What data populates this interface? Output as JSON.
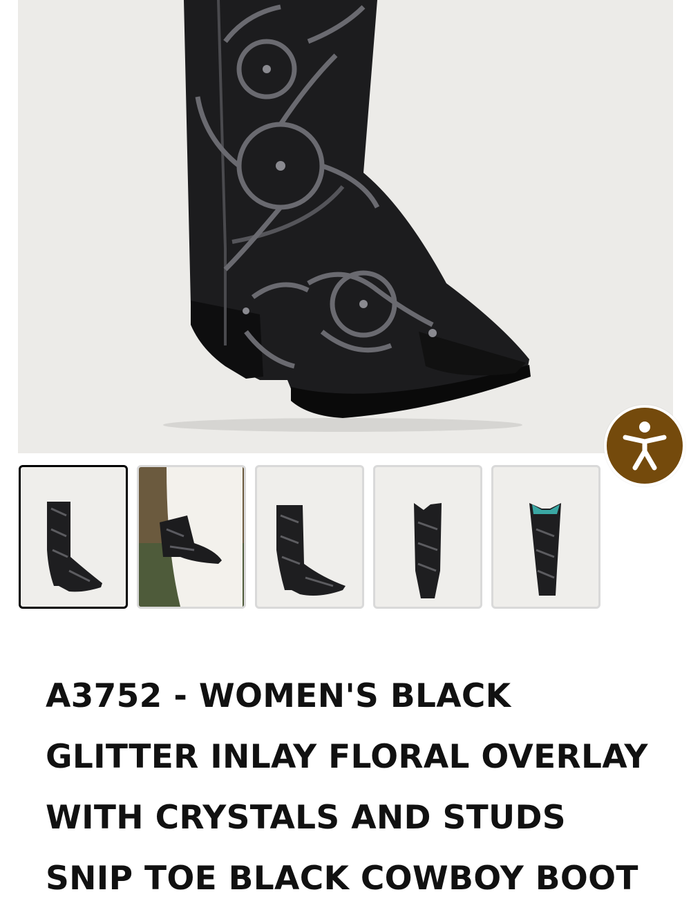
{
  "product": {
    "title_lines": [
      "A3752 - WOMEN'S BLACK",
      "GLITTER INLAY FLORAL OVERLAY",
      "WITH CRYSTALS AND STUDS",
      "SNIP TOE BLACK COWBOY BOOT"
    ]
  },
  "gallery": {
    "main_image": "boot-photo",
    "thumbnails": [
      {
        "name": "thumbnail-1",
        "selected": true
      },
      {
        "name": "thumbnail-2",
        "selected": false
      },
      {
        "name": "thumbnail-3",
        "selected": false
      },
      {
        "name": "thumbnail-4",
        "selected": false
      },
      {
        "name": "thumbnail-5",
        "selected": false
      }
    ]
  },
  "accessibility": {
    "icon": "accessibility-icon"
  },
  "colors": {
    "hero_bg": "#ecebe8",
    "accessibility_button": "#744a0c",
    "thumbnail_border_active": "#000000",
    "thumbnail_border": "#d9d9d9",
    "title_text": "#111111"
  }
}
